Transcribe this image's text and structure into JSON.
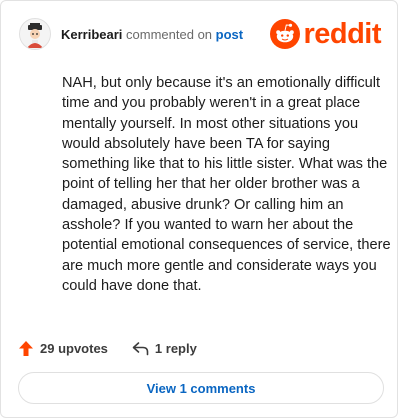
{
  "comment": {
    "username": "Kerribeari",
    "action_text": "commented on",
    "post_link": "post",
    "body": "NAH, but only because it's an emotionally difficult time and you probably weren't in a great place mentally yourself. In most other situations you would absolutely have been TA for saying something like that to his little sister. What was the point of telling her that her older brother was a damaged, abusive drunk? Or calling him an asshole? If you wanted to warn her about the potential emotional consequences of service, there are much more gentle and considerate ways you could have done that."
  },
  "brand": {
    "wordmark": "reddit",
    "color": "#ff4500"
  },
  "actions": {
    "upvotes_label": "29 upvotes",
    "reply_label": "1 reply",
    "upvote_icon": "upvote-arrow-icon",
    "reply_icon": "reply-arrow-icon"
  },
  "view_comments_label": "View 1 comments",
  "colors": {
    "accent": "#ff4500",
    "link": "#0a66c2"
  }
}
